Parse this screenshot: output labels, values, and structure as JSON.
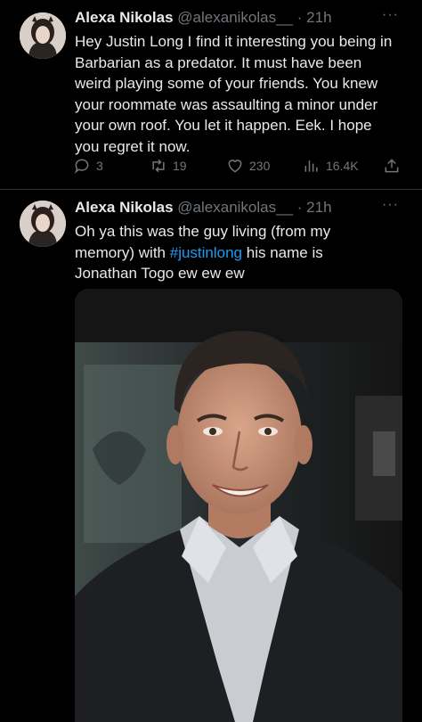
{
  "tweets": [
    {
      "author_name": "Alexa Nikolas",
      "handle": "@alexanikolas__",
      "separator": "·",
      "time": "21h",
      "text": "Hey Justin Long I find it interesting you being in\nBarbarian as a predator. It must have been\nweird playing some of your friends. You knew\nyour roommate was  assaulting a minor under\nyour own roof. You let it happen. Eek. I hope\nyou regret it now.",
      "replies": "3",
      "retweets": "19",
      "likes": "230",
      "views": "16.4K"
    },
    {
      "author_name": "Alexa Nikolas",
      "handle": "@alexanikolas__",
      "separator": "·",
      "time": "21h",
      "text_part1": "Oh ya this was the guy living (from my\nmemory)  with ",
      "hashtag": "#justinlong",
      "text_part2": " his name is\nJonathan Togo ew ew ew"
    }
  ],
  "more_label": "···",
  "colors": {
    "background": "#000000",
    "text": "#e7e9ea",
    "secondary": "#71767b",
    "link": "#1d9bf0"
  },
  "icons": [
    "reply-icon",
    "retweet-icon",
    "like-icon",
    "views-icon",
    "share-icon",
    "more-icon"
  ]
}
